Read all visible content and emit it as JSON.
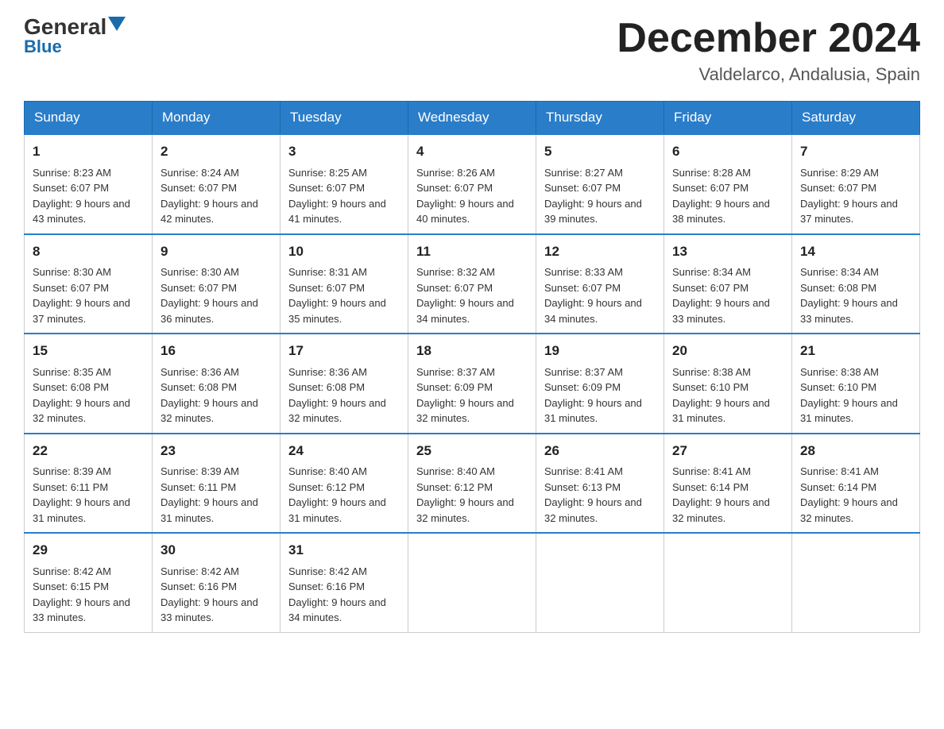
{
  "header": {
    "logo_line1": "General",
    "logo_line2": "Blue",
    "month_title": "December 2024",
    "subtitle": "Valdelarco, Andalusia, Spain"
  },
  "days_of_week": [
    "Sunday",
    "Monday",
    "Tuesday",
    "Wednesday",
    "Thursday",
    "Friday",
    "Saturday"
  ],
  "weeks": [
    [
      {
        "day": 1,
        "sunrise": "8:23 AM",
        "sunset": "6:07 PM",
        "daylight": "9 hours and 43 minutes."
      },
      {
        "day": 2,
        "sunrise": "8:24 AM",
        "sunset": "6:07 PM",
        "daylight": "9 hours and 42 minutes."
      },
      {
        "day": 3,
        "sunrise": "8:25 AM",
        "sunset": "6:07 PM",
        "daylight": "9 hours and 41 minutes."
      },
      {
        "day": 4,
        "sunrise": "8:26 AM",
        "sunset": "6:07 PM",
        "daylight": "9 hours and 40 minutes."
      },
      {
        "day": 5,
        "sunrise": "8:27 AM",
        "sunset": "6:07 PM",
        "daylight": "9 hours and 39 minutes."
      },
      {
        "day": 6,
        "sunrise": "8:28 AM",
        "sunset": "6:07 PM",
        "daylight": "9 hours and 38 minutes."
      },
      {
        "day": 7,
        "sunrise": "8:29 AM",
        "sunset": "6:07 PM",
        "daylight": "9 hours and 37 minutes."
      }
    ],
    [
      {
        "day": 8,
        "sunrise": "8:30 AM",
        "sunset": "6:07 PM",
        "daylight": "9 hours and 37 minutes."
      },
      {
        "day": 9,
        "sunrise": "8:30 AM",
        "sunset": "6:07 PM",
        "daylight": "9 hours and 36 minutes."
      },
      {
        "day": 10,
        "sunrise": "8:31 AM",
        "sunset": "6:07 PM",
        "daylight": "9 hours and 35 minutes."
      },
      {
        "day": 11,
        "sunrise": "8:32 AM",
        "sunset": "6:07 PM",
        "daylight": "9 hours and 34 minutes."
      },
      {
        "day": 12,
        "sunrise": "8:33 AM",
        "sunset": "6:07 PM",
        "daylight": "9 hours and 34 minutes."
      },
      {
        "day": 13,
        "sunrise": "8:34 AM",
        "sunset": "6:07 PM",
        "daylight": "9 hours and 33 minutes."
      },
      {
        "day": 14,
        "sunrise": "8:34 AM",
        "sunset": "6:08 PM",
        "daylight": "9 hours and 33 minutes."
      }
    ],
    [
      {
        "day": 15,
        "sunrise": "8:35 AM",
        "sunset": "6:08 PM",
        "daylight": "9 hours and 32 minutes."
      },
      {
        "day": 16,
        "sunrise": "8:36 AM",
        "sunset": "6:08 PM",
        "daylight": "9 hours and 32 minutes."
      },
      {
        "day": 17,
        "sunrise": "8:36 AM",
        "sunset": "6:08 PM",
        "daylight": "9 hours and 32 minutes."
      },
      {
        "day": 18,
        "sunrise": "8:37 AM",
        "sunset": "6:09 PM",
        "daylight": "9 hours and 32 minutes."
      },
      {
        "day": 19,
        "sunrise": "8:37 AM",
        "sunset": "6:09 PM",
        "daylight": "9 hours and 31 minutes."
      },
      {
        "day": 20,
        "sunrise": "8:38 AM",
        "sunset": "6:10 PM",
        "daylight": "9 hours and 31 minutes."
      },
      {
        "day": 21,
        "sunrise": "8:38 AM",
        "sunset": "6:10 PM",
        "daylight": "9 hours and 31 minutes."
      }
    ],
    [
      {
        "day": 22,
        "sunrise": "8:39 AM",
        "sunset": "6:11 PM",
        "daylight": "9 hours and 31 minutes."
      },
      {
        "day": 23,
        "sunrise": "8:39 AM",
        "sunset": "6:11 PM",
        "daylight": "9 hours and 31 minutes."
      },
      {
        "day": 24,
        "sunrise": "8:40 AM",
        "sunset": "6:12 PM",
        "daylight": "9 hours and 31 minutes."
      },
      {
        "day": 25,
        "sunrise": "8:40 AM",
        "sunset": "6:12 PM",
        "daylight": "9 hours and 32 minutes."
      },
      {
        "day": 26,
        "sunrise": "8:41 AM",
        "sunset": "6:13 PM",
        "daylight": "9 hours and 32 minutes."
      },
      {
        "day": 27,
        "sunrise": "8:41 AM",
        "sunset": "6:14 PM",
        "daylight": "9 hours and 32 minutes."
      },
      {
        "day": 28,
        "sunrise": "8:41 AM",
        "sunset": "6:14 PM",
        "daylight": "9 hours and 32 minutes."
      }
    ],
    [
      {
        "day": 29,
        "sunrise": "8:42 AM",
        "sunset": "6:15 PM",
        "daylight": "9 hours and 33 minutes."
      },
      {
        "day": 30,
        "sunrise": "8:42 AM",
        "sunset": "6:16 PM",
        "daylight": "9 hours and 33 minutes."
      },
      {
        "day": 31,
        "sunrise": "8:42 AM",
        "sunset": "6:16 PM",
        "daylight": "9 hours and 34 minutes."
      },
      null,
      null,
      null,
      null
    ]
  ]
}
